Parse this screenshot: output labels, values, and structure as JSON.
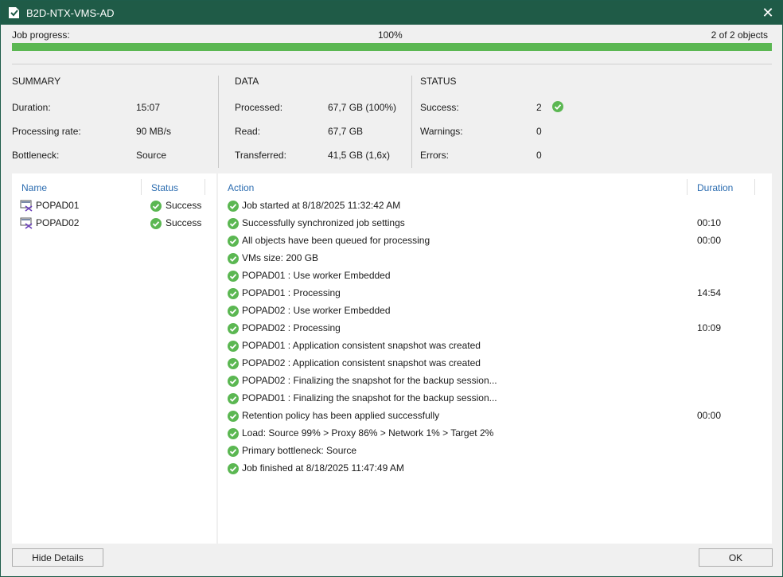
{
  "window": {
    "title": "B2D-NTX-VMS-AD"
  },
  "progress": {
    "label": "Job progress:",
    "percent_text": "100%",
    "objects_text": "2 of 2 objects",
    "fraction": 1.0,
    "color": "#5bb752"
  },
  "summary": {
    "heading": "SUMMARY",
    "rows": [
      {
        "label": "Duration:",
        "value": "15:07"
      },
      {
        "label": "Processing rate:",
        "value": "90 MB/s"
      },
      {
        "label": "Bottleneck:",
        "value": "Source"
      }
    ]
  },
  "data": {
    "heading": "DATA",
    "rows": [
      {
        "label": "Processed:",
        "value": "67,7 GB (100%)"
      },
      {
        "label": "Read:",
        "value": "67,7 GB"
      },
      {
        "label": "Transferred:",
        "value": "41,5 GB (1,6x)"
      }
    ]
  },
  "status": {
    "heading": "STATUS",
    "rows": [
      {
        "label": "Success:",
        "value": "2"
      },
      {
        "label": "Warnings:",
        "value": "0"
      },
      {
        "label": "Errors:",
        "value": "0"
      }
    ]
  },
  "objects": {
    "headers": {
      "name": "Name",
      "status": "Status"
    },
    "items": [
      {
        "name": "POPAD01",
        "status": "Success"
      },
      {
        "name": "POPAD02",
        "status": "Success"
      }
    ]
  },
  "log": {
    "headers": {
      "action": "Action",
      "duration": "Duration"
    },
    "items": [
      {
        "action": "Job started at 8/18/2025 11:32:42 AM",
        "duration": ""
      },
      {
        "action": "Successfully synchronized job settings",
        "duration": "00:10"
      },
      {
        "action": "All objects have been queued for processing",
        "duration": "00:00"
      },
      {
        "action": "VMs size: 200 GB",
        "duration": ""
      },
      {
        "action": "POPAD01 : Use worker Embedded",
        "duration": ""
      },
      {
        "action": "POPAD01 : Processing",
        "duration": "14:54"
      },
      {
        "action": "POPAD02 : Use worker Embedded",
        "duration": ""
      },
      {
        "action": "POPAD02 : Processing",
        "duration": "10:09"
      },
      {
        "action": "POPAD01 : Application consistent snapshot was created",
        "duration": ""
      },
      {
        "action": "POPAD02 : Application consistent snapshot was created",
        "duration": ""
      },
      {
        "action": "POPAD02 : Finalizing the snapshot for the backup session...",
        "duration": ""
      },
      {
        "action": "POPAD01 : Finalizing the snapshot for the backup session...",
        "duration": ""
      },
      {
        "action": "Retention policy has been applied successfully",
        "duration": "00:00"
      },
      {
        "action": "Load: Source 99% > Proxy 86% > Network 1% > Target 2%",
        "duration": ""
      },
      {
        "action": "Primary bottleneck: Source",
        "duration": ""
      },
      {
        "action": "Job finished at 8/18/2025 11:47:49 AM",
        "duration": ""
      }
    ]
  },
  "buttons": {
    "hide_details": "Hide Details",
    "ok": "OK"
  },
  "icons": {
    "success": "check-circle-icon",
    "vm": "vm-icon",
    "app": "veeam-job-icon",
    "close": "close-icon"
  },
  "colors": {
    "titlebar": "#1f5b47",
    "success": "#5bb752",
    "link": "#2b6cb0"
  }
}
